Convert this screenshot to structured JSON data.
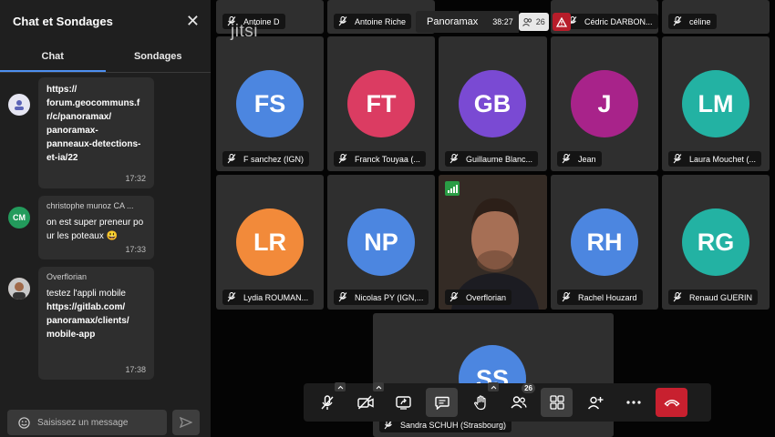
{
  "chat": {
    "title": "Chat et Sondages",
    "close_icon": "close-icon",
    "tabs": [
      {
        "label": "Chat"
      },
      {
        "label": "Sondages"
      }
    ],
    "messages": [
      {
        "sender": "",
        "avatar_initials": "",
        "avatar_color": "#e6e6f2",
        "lines": [
          "https://",
          "forum.geocommuns.f",
          "r/c/panoramax/",
          "panoramax-",
          "panneaux-detections-",
          "et-ia/22"
        ],
        "time": "17:32"
      },
      {
        "sender": "christophe munoz CA ...",
        "avatar_initials": "CM",
        "avatar_color": "#239b5c",
        "lines": [
          "on est super preneur pour les poteaux 😃"
        ],
        "time": "17:33"
      },
      {
        "sender": "Overflorian",
        "avatar_initials": "",
        "avatar_color": "#8b5a3c",
        "line1": "testez l'appli mobile",
        "link_lines": [
          "https://gitlab.com/",
          "panoramax/clients/",
          "mobile-app"
        ],
        "time": "17:38"
      }
    ],
    "composer_placeholder": "Saisissez un message"
  },
  "meeting": {
    "title": "Panoramax",
    "elapsed": "38:27",
    "participant_count": "26",
    "logo_text": "jitsi"
  },
  "top_row": [
    {
      "name": "Antoine D"
    },
    {
      "name": "Antoine Riche"
    },
    {
      "name": "Cédric DARBON..."
    },
    {
      "name": "céline"
    }
  ],
  "tiles": [
    {
      "initials": "FS",
      "name": "F sanchez (IGN)",
      "color": "#4c86e0"
    },
    {
      "initials": "FT",
      "name": "Franck Touyaa (...",
      "color": "#db3c62"
    },
    {
      "initials": "GB",
      "name": "Guillaume Blanc...",
      "color": "#7a4ad3"
    },
    {
      "initials": "J",
      "name": "Jean",
      "color": "#a8238a"
    },
    {
      "initials": "LM",
      "name": "Laura Mouchet (...",
      "color": "#23b2a3"
    },
    {
      "initials": "LR",
      "name": "Lydia ROUMAN...",
      "color": "#f28a3a"
    },
    {
      "initials": "NP",
      "name": "Nicolas PY (IGN,...",
      "color": "#4c86e0"
    },
    {
      "initials": "",
      "name": "Overflorian",
      "color": "#5b3a28"
    },
    {
      "initials": "RH",
      "name": "Rachel Houzard",
      "color": "#4c86e0"
    },
    {
      "initials": "RG",
      "name": "Renaud GUERIN",
      "color": "#23b2a3"
    },
    {
      "initials": "SS",
      "name": "Sandra SCHUH (Strasbourg)",
      "color": "#4c86e0"
    }
  ],
  "toolbar": {
    "participants_badge": "26",
    "buttons": [
      "mic-off-icon",
      "camera-off-icon",
      "screen-share-icon",
      "chat-icon",
      "raise-hand-icon",
      "participants-icon",
      "tile-view-icon",
      "invite-icon",
      "more-icon",
      "hangup-icon"
    ]
  }
}
